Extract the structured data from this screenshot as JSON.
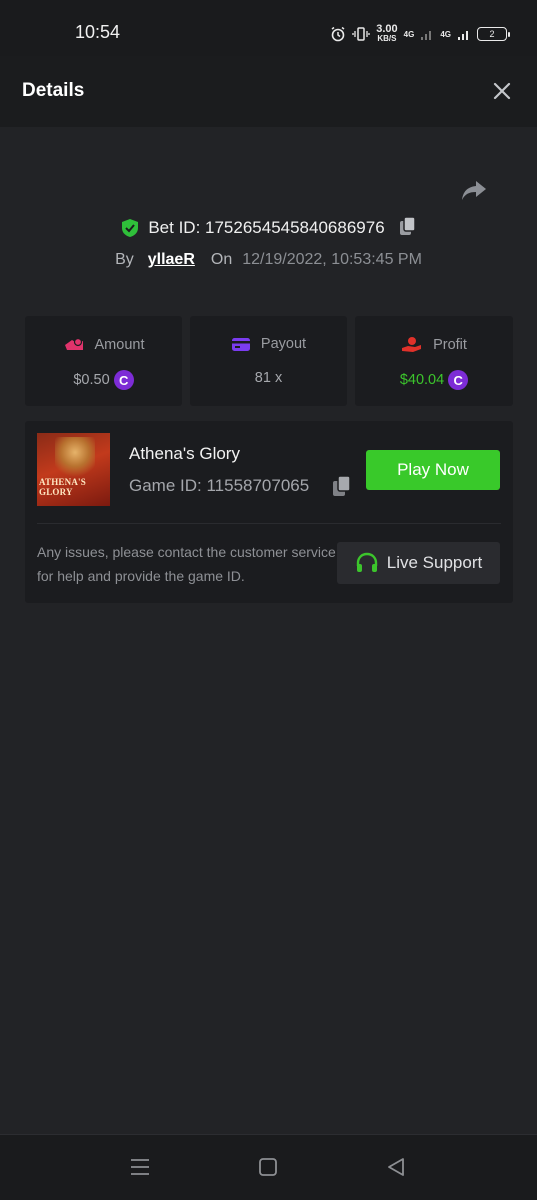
{
  "status_bar": {
    "time": "10:54",
    "net_speed_value": "3.00",
    "net_speed_unit": "KB/S",
    "network_1": "4G",
    "network_2": "4G",
    "battery": "2"
  },
  "header": {
    "title": "Details"
  },
  "bet": {
    "id_label": "Bet ID: 1752654545840686976",
    "by_label": "By",
    "username": "yllaeR",
    "on_label": "On",
    "datetime": "12/19/2022, 10:53:45 PM"
  },
  "stats": [
    {
      "label": "Amount",
      "value": "$0.50",
      "icon": "coins-icon",
      "icon_color": "#e0336b"
    },
    {
      "label": "Payout",
      "value": "81 x",
      "icon": "card-icon",
      "icon_color": "#7b3cf0"
    },
    {
      "label": "Profit",
      "value": "$40.04",
      "icon": "hand-coins-icon",
      "icon_color": "#e0312a"
    }
  ],
  "currency_symbol": "C",
  "game": {
    "title": "Athena's Glory",
    "game_id_label": "Game ID: 11558707065",
    "thumbnail_text": "ATHENA'S GLORY",
    "play_label": "Play Now"
  },
  "support": {
    "text": "Any issues, please contact the customer service for help and provide the game ID.",
    "button_label": "Live Support"
  },
  "colors": {
    "background": "#222326",
    "card": "#1b1c1f",
    "accent_green": "#39c92a",
    "profit_green": "#3cc52c",
    "coin_purple": "#7d2cd6"
  }
}
